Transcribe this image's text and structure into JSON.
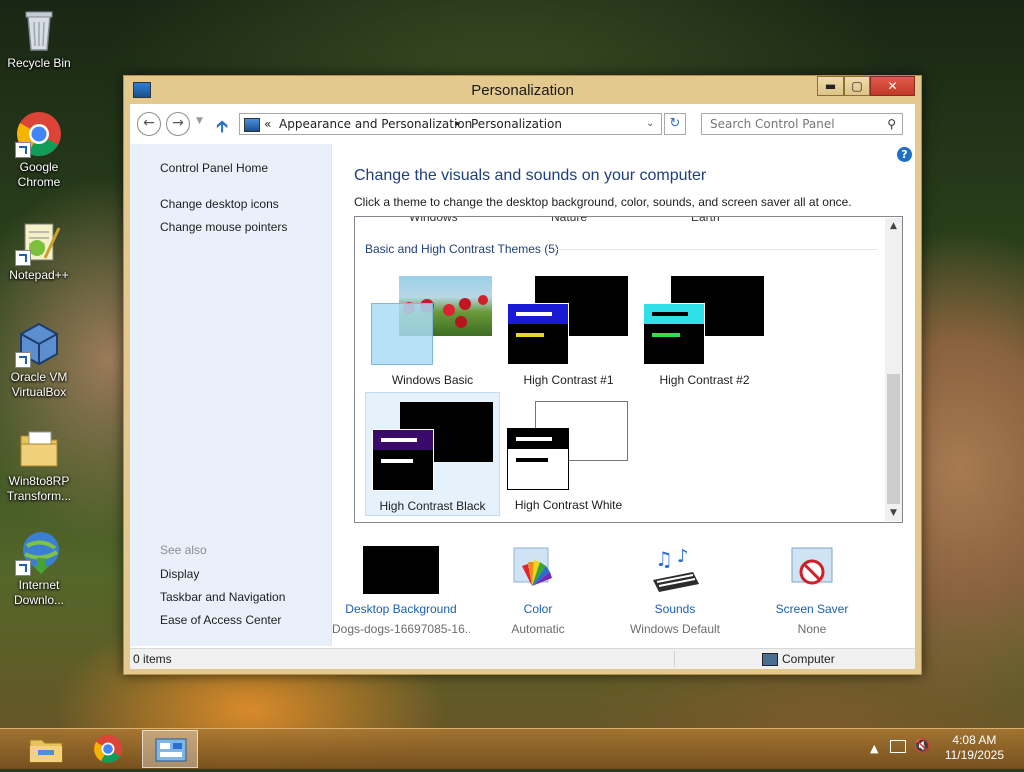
{
  "desktop": {
    "icons": [
      {
        "label_lines": [
          "Recycle Bin"
        ],
        "icon": "recycle-bin-icon"
      },
      {
        "label_lines": [
          "Google",
          "Chrome"
        ],
        "icon": "chrome-icon"
      },
      {
        "label_lines": [
          "Notepad++"
        ],
        "icon": "notepad-plus-plus-icon"
      },
      {
        "label_lines": [
          "Oracle VM",
          "VirtualBox"
        ],
        "icon": "virtualbox-icon"
      },
      {
        "label_lines": [
          "Win8to8RP",
          "Transform..."
        ],
        "icon": "folder-icon"
      },
      {
        "label_lines": [
          "Internet",
          "Downlo..."
        ],
        "icon": "internet-download-manager-icon"
      }
    ]
  },
  "window": {
    "title": "Personalization",
    "controls": {
      "minimize": "▬",
      "maximize": "▢",
      "close": "✕"
    }
  },
  "address": {
    "prefix": "«",
    "crumbs": [
      "Appearance and Personalization",
      "Personalization"
    ],
    "separator": "▸",
    "search_placeholder": "Search Control Panel"
  },
  "sidebar": {
    "home": "Control Panel Home",
    "links": [
      "Change desktop icons",
      "Change mouse pointers"
    ],
    "see_also_title": "See also",
    "see_also": [
      "Display",
      "Taskbar and Navigation",
      "Ease of Access Center"
    ]
  },
  "main": {
    "heading": "Change the visuals and sounds on your computer",
    "subtext": "Click a theme to change the desktop background, color, sounds, and screen saver all at once.",
    "partial_labels": [
      "Windows",
      "Nature",
      "Earth"
    ],
    "group_title": "Basic and High Contrast Themes (5)",
    "themes": [
      {
        "name": "Windows Basic",
        "selected": false
      },
      {
        "name": "High Contrast #1",
        "selected": false
      },
      {
        "name": "High Contrast #2",
        "selected": false
      },
      {
        "name": "High Contrast Black",
        "selected": true
      },
      {
        "name": "High Contrast White",
        "selected": false
      }
    ]
  },
  "bottom": [
    {
      "link": "Desktop Background",
      "value": "Dogs-dogs-16697085-16..."
    },
    {
      "link": "Color",
      "value": "Automatic"
    },
    {
      "link": "Sounds",
      "value": "Windows Default"
    },
    {
      "link": "Screen Saver",
      "value": "None"
    }
  ],
  "status": {
    "items": "0 items",
    "location": "Computer"
  },
  "taskbar": {
    "apps": [
      "file-explorer-icon",
      "chrome-icon",
      "control-panel-icon"
    ],
    "time": "4:08 AM",
    "date": "11/19/2025"
  },
  "colors": {
    "accent_link": "#1a5fb4",
    "heading": "#1f3f7f",
    "close_red": "#c0392b",
    "frame": "#e3c98e"
  }
}
